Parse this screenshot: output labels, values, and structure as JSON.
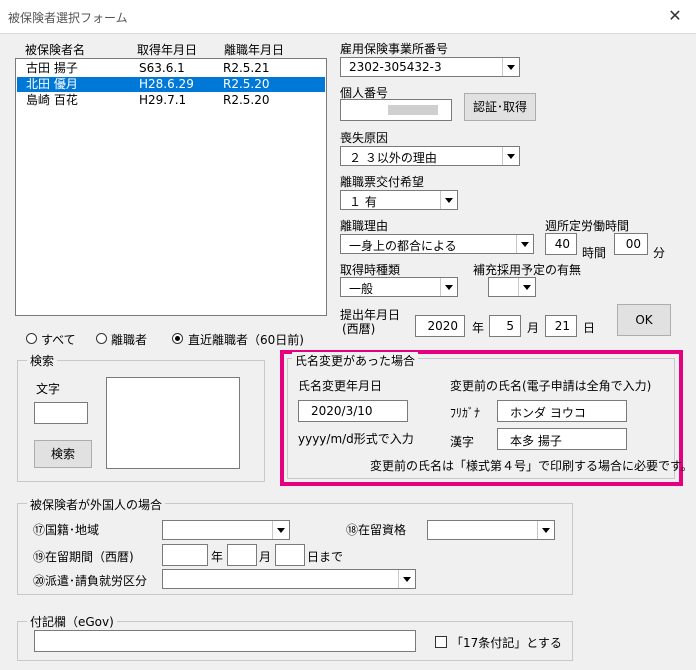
{
  "window": {
    "title": "被保険者選択フォーム",
    "close": "✕"
  },
  "list": {
    "headers": [
      "被保険者名",
      "取得年月日",
      "離職年月日"
    ],
    "rows": [
      {
        "name": "古田 揚子",
        "acquired": "S63.6.1",
        "left": "R2.5.21",
        "selected": false
      },
      {
        "name": "北田 優月",
        "acquired": "H28.6.29",
        "left": "R2.5.20",
        "selected": true
      },
      {
        "name": "島崎 百花",
        "acquired": "H29.7.1",
        "left": "R2.5.20",
        "selected": false
      }
    ]
  },
  "right": {
    "office_label": "雇用保険事業所番号",
    "office_value": "2302-305432-3",
    "mynumber_label": "個人番号",
    "auth_button": "認証･取得",
    "loss_reason_label": "喪失原因",
    "loss_reason_value": "２ ３以外の理由",
    "certificate_label": "離職票交付希望",
    "certificate_value": "１ 有",
    "reason_label": "離職理由",
    "reason_value": "一身上の都合による",
    "hours_label": "週所定労働時間",
    "hours_value": "40",
    "hours_unit": "時間",
    "minutes_value": "00",
    "minutes_unit": "分",
    "acq_type_label": "取得時種類",
    "acq_type_value": "一般",
    "supplement_label": "補充採用予定の有無",
    "supplement_value": "",
    "submit_label_1": "提出年月日",
    "submit_label_2": "(西暦)",
    "submit_year": "2020",
    "year_unit": "年",
    "submit_month": "5",
    "month_unit": "月",
    "submit_day": "21",
    "day_unit": "日",
    "ok_button": "OK"
  },
  "filter": {
    "options": [
      "すべて",
      "離職者",
      "直近離職者（60日前)"
    ],
    "selected_index": 2
  },
  "search": {
    "legend": "検索",
    "text_label": "文字",
    "text_value": "",
    "button": "検索"
  },
  "name_change": {
    "legend": "氏名変更があった場合",
    "date_label": "氏名変更年月日",
    "date_value": "2020/3/10",
    "format_hint": "yyyy/m/d形式で入力",
    "prev_name_label": "変更前の氏名(電子申請は全角で入力)",
    "furigana_label": "ﾌﾘｶﾞﾅ",
    "furigana_value": "ホンダ ヨウコ",
    "kanji_label": "漢字",
    "kanji_value": "本多 揚子",
    "note": "変更前の氏名は「様式第４号」で印刷する場合に必要です。",
    "highlight_color": "#e6007e"
  },
  "foreigner": {
    "legend": "被保険者が外国人の場合",
    "nationality_label": "⑰国籍･地域",
    "nationality_value": "",
    "status_label": "⑱在留資格",
    "status_value": "",
    "period_label": "⑲在留期間（西暦)",
    "period_year_unit": "年",
    "period_month_unit": "月",
    "period_day_unit": "日まで",
    "dispatch_label": "⑳派遣･請負就労区分",
    "dispatch_value": ""
  },
  "memo": {
    "legend": "付記欄（eGov)",
    "value": "",
    "checkbox_label": "「17条付記」とする",
    "checked": false
  },
  "colors": {
    "selection": "#0078d7",
    "background": "#f0f0f0"
  }
}
